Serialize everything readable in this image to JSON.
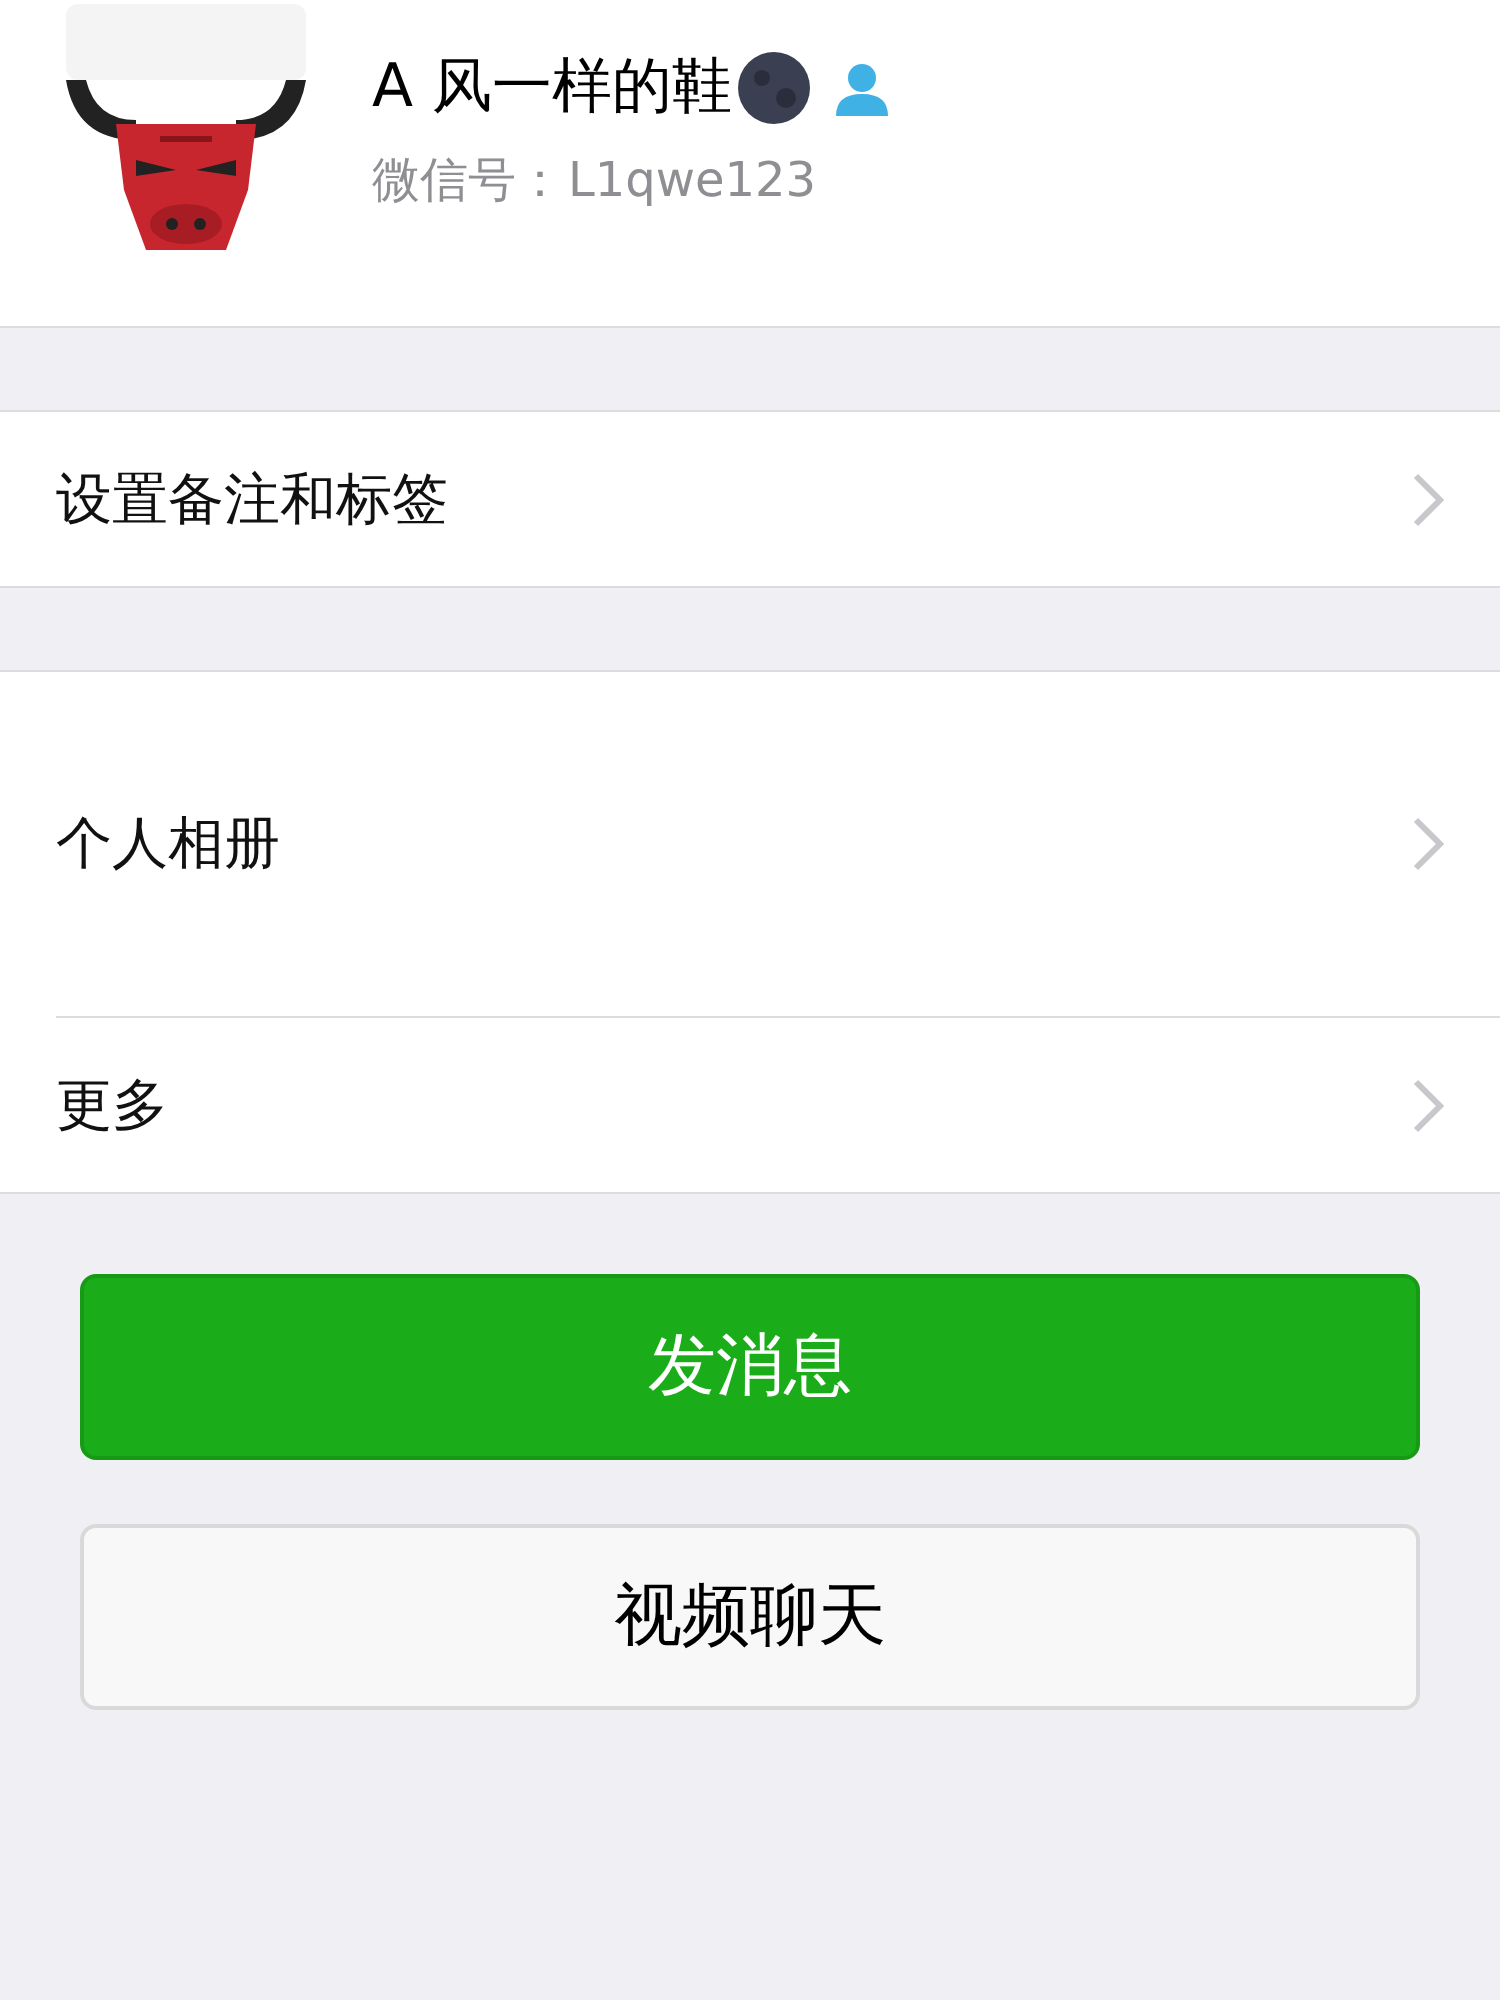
{
  "profile": {
    "name": "A 风一样的鞋",
    "wechat_id_label": "微信号：",
    "wechat_id": "L1qwe123"
  },
  "sections": [
    {
      "items": [
        {
          "label": "设置备注和标签",
          "kind": "normal"
        }
      ]
    },
    {
      "items": [
        {
          "label": "个人相册",
          "kind": "album"
        },
        {
          "label": "更多",
          "kind": "normal"
        }
      ]
    }
  ],
  "buttons": [
    {
      "label": "发消息",
      "kind": "primary"
    },
    {
      "label": "视频聊天",
      "kind": "secondary"
    }
  ]
}
